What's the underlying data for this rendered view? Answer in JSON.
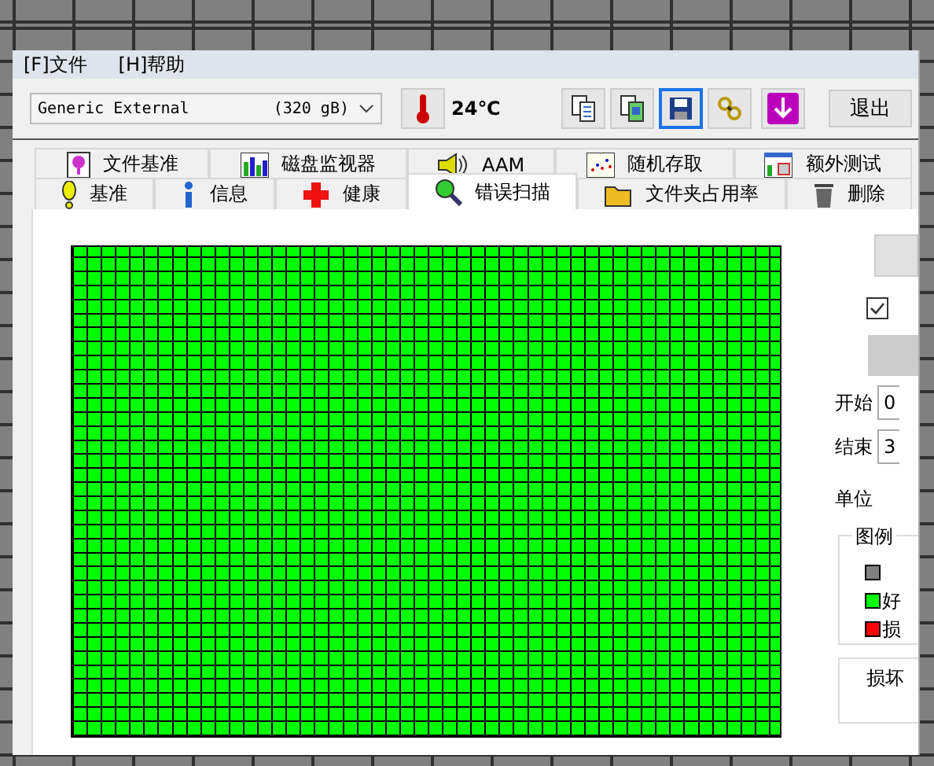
{
  "menu": [
    {
      "label": "[F]文件"
    },
    {
      "label": "[H]帮助"
    }
  ],
  "toolbar": {
    "drive": "Generic External",
    "capacity": "(320 gB)",
    "temperature": "24℃",
    "tool_buttons": [
      {
        "selected": false
      },
      {
        "selected": false
      },
      {
        "selected": true
      },
      {
        "selected": false
      },
      {
        "selected": false
      }
    ],
    "exit": "退出"
  },
  "tabs_back": [
    {
      "label": "文件基准",
      "selected": false
    },
    {
      "label": "磁盘监视器",
      "selected": false
    },
    {
      "label": "AAM",
      "selected": false
    },
    {
      "label": "随机存取",
      "selected": false
    },
    {
      "label": "额外测试",
      "selected": false
    }
  ],
  "tabs_front": [
    {
      "label": "基准",
      "selected": false
    },
    {
      "label": "信息",
      "selected": false
    },
    {
      "label": "健康",
      "selected": false
    },
    {
      "label": "错误扫描",
      "selected": true
    },
    {
      "label": "文件夹占用率",
      "selected": false
    },
    {
      "label": "删除",
      "selected": false
    }
  ],
  "scan": {
    "checkbox": {
      "checked": true
    },
    "start_label": "开始",
    "start_value": "0",
    "end_label": "结束",
    "end_value": "3",
    "unit_label": "单位",
    "legend": {
      "title": "图例",
      "items": [
        {
          "color": "#808080"
        },
        {
          "label": "好",
          "color": "#00ff00"
        },
        {
          "label": "损",
          "color": "#ff0000"
        }
      ]
    },
    "damaged_label": "损坏"
  }
}
